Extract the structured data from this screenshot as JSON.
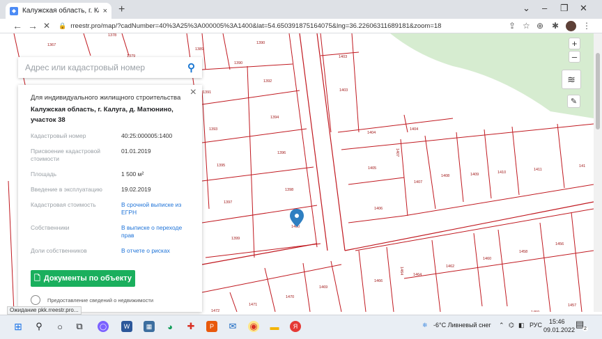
{
  "browser": {
    "tab_title": "Калужская область, г. Калуга, д.",
    "tab_close": "×",
    "new_tab": "+",
    "url": "rreestr.pro/map/?cadNumber=40%3A25%3A000005%3A1400&lat=54.650391875164075&lng=36.22606311689181&zoom=18",
    "window_controls": {
      "chevron": "⌄",
      "minimize": "–",
      "restore": "❐",
      "close": "✕"
    },
    "nav": {
      "back": "←",
      "forward": "→",
      "stop": "✕"
    }
  },
  "map": {
    "search_placeholder": "Адрес или кадастровый номер",
    "zoom_in": "+",
    "zoom_out": "–",
    "parcels": [
      "1367",
      "1378",
      "1379",
      "1389",
      "1390",
      "1390",
      "1391",
      "1392",
      "1393",
      "1394",
      "1395",
      "1396",
      "1397",
      "1398",
      "1399",
      "1400",
      "1403",
      "1403",
      "1404",
      "1404",
      "1405",
      "1406",
      "1407",
      "1408",
      "1409",
      "1410",
      "1411",
      "141",
      "1456",
      "1457",
      "1458",
      "1459",
      "1460",
      "1462",
      "1464",
      "1464",
      "1466",
      "1469",
      "1470",
      "1471",
      "1472",
      "1368"
    ]
  },
  "panel": {
    "close": "×",
    "type": "Для индивидуального жилищного строительства",
    "address": "Калужская область, г. Калуга, д. Матюнино, участок 38",
    "rows": [
      {
        "k": "Кадастровый номер",
        "v": "40:25:000005:1400",
        "link": false
      },
      {
        "k": "Присвоение кадастровой стоимости",
        "v": "01.01.2019",
        "link": false
      },
      {
        "k": "Площадь",
        "v": "1 500 м²",
        "link": false
      },
      {
        "k": "Введение в эксплуатацию",
        "v": "19.02.2019",
        "link": false
      },
      {
        "k": "Кадастровая стоимость",
        "v": "В срочной выписке из ЕГРН",
        "link": true
      },
      {
        "k": "Собственники",
        "v": "В выписке о переходе прав",
        "link": true
      },
      {
        "k": "Доли собственников",
        "v": "В отчете о рисках",
        "link": true
      }
    ],
    "doc_button": "Документы по объекту",
    "provide_text": "Предоставление сведений о недвижимости"
  },
  "status_text": "Ожидание pkk.rreestr.pro...",
  "taskbar": {
    "weather": "-6°C  Ливневый снег",
    "lang": "РУС",
    "time": "15:46",
    "date": "09.01.2022",
    "notif_count": "2"
  },
  "colors": {
    "accent_green": "#1aaf5d",
    "link": "#1e73d8",
    "parcel_line": "#c0181f",
    "park": "#d6ecd0"
  }
}
